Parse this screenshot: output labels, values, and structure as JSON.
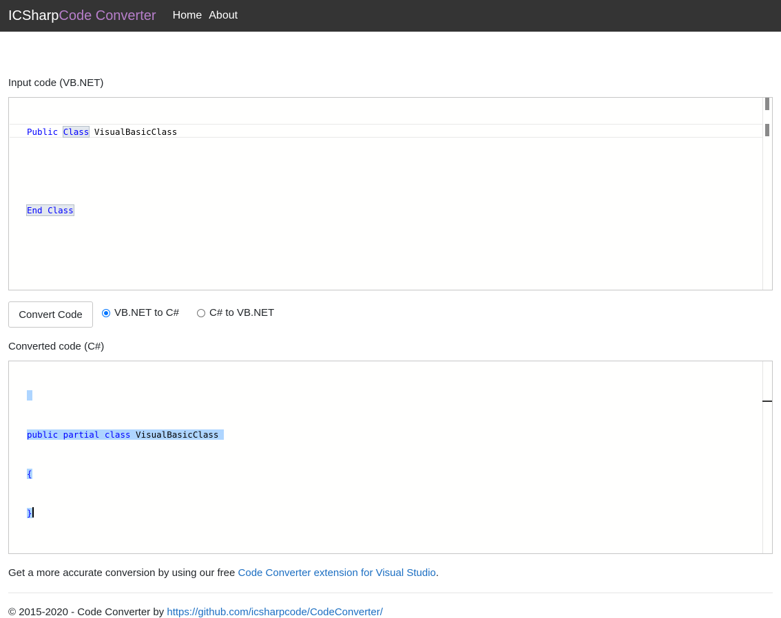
{
  "navbar": {
    "brand_part1": "ICSharp",
    "brand_part2": "Code Converter",
    "links": [
      "Home",
      "About"
    ]
  },
  "input": {
    "label": "Input code (VB.NET)",
    "lines": [
      {
        "kw1": "Public",
        "kw2": "Class",
        "text": " VisualBasicClass"
      },
      {
        "kw1": "",
        "kw2": "",
        "text": ""
      },
      {
        "kw1": "End",
        "kw2": "Class",
        "text": ""
      }
    ]
  },
  "controls": {
    "convert_button": "Convert Code",
    "radio_options": [
      {
        "label": "VB.NET to C#",
        "checked": true
      },
      {
        "label": "C# to VB.NET",
        "checked": false
      }
    ]
  },
  "output": {
    "label": "Converted code (C#)",
    "line1_keywords": "public partial class",
    "line1_text": " VisualBasicClass",
    "line2": "{",
    "line3": "}"
  },
  "footer": {
    "promo_prefix": "Get a more accurate conversion by using our free ",
    "promo_link": "Code Converter extension for Visual Studio",
    "promo_suffix": ".",
    "copyright_prefix": "© 2015-2020 - Code Converter by ",
    "copyright_link": "https://github.com/icsharpcode/CodeConverter/"
  },
  "colors": {
    "navbar_bg": "#343434",
    "brand_accent": "#b77fcb",
    "link": "#1b6ec2",
    "keyword": "#0000ff",
    "selection": "#aed5ff"
  }
}
